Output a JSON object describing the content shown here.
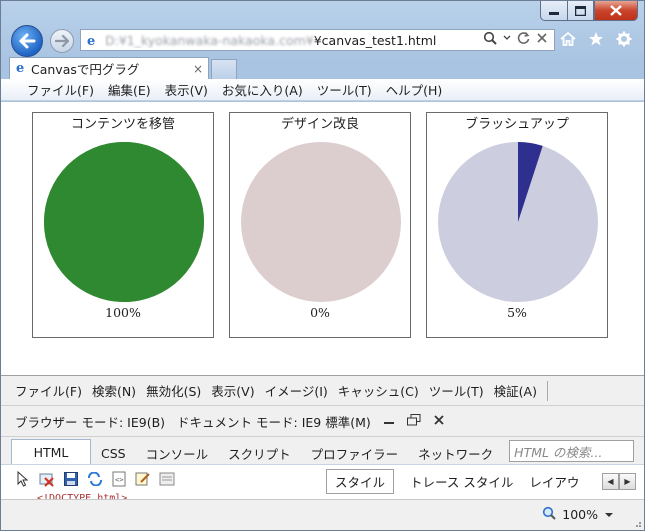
{
  "address": {
    "url_hidden": "D:¥1_kyokanwaka-nakaoka.com¥",
    "url_visible": "¥canvas_test1.html"
  },
  "tab": {
    "title": "Canvasで円グラグ",
    "close": "×"
  },
  "menu": [
    "ファイル(F)",
    "編集(E)",
    "表示(V)",
    "お気に入り(A)",
    "ツール(T)",
    "ヘルプ(H)"
  ],
  "charts": [
    {
      "title": "コンテンツを移管",
      "percent": 100,
      "label": "100%",
      "color": "#2e8930",
      "base": "#2e8930"
    },
    {
      "title": "デザイン改良",
      "percent": 0,
      "label": "0%",
      "color": "#2e2f8f",
      "base": "#dccdce"
    },
    {
      "title": "ブラッシュアップ",
      "percent": 5,
      "label": "5%",
      "color": "#2e2f8f",
      "base": "#cccdde"
    }
  ],
  "chart_data": {
    "type": "pie",
    "charts": [
      {
        "title": "コンテンツを移管",
        "value": 100,
        "unit": "%"
      },
      {
        "title": "デザイン改良",
        "value": 0,
        "unit": "%"
      },
      {
        "title": "ブラッシュアップ",
        "value": 5,
        "unit": "%"
      }
    ]
  },
  "devtools": {
    "menu": [
      "ファイル(F)",
      "検索(N)",
      "無効化(S)",
      "表示(V)",
      "イメージ(I)",
      "キャッシュ(C)",
      "ツール(T)",
      "検証(A)"
    ],
    "browser_mode": "ブラウザー モード: IE9(B)",
    "document_mode": "ドキュメント モード:  IE9 標準(M)",
    "tabs": [
      "HTML",
      "CSS",
      "コンソール",
      "スクリプト",
      "プロファイラー",
      "ネットワーク"
    ],
    "search_placeholder": "HTML の検索...",
    "source_snippet": "<!DOCTYPE html>",
    "right_tabs": [
      "スタイル",
      "トレース スタイル",
      "レイアウ"
    ]
  },
  "status": {
    "zoom": "100%"
  }
}
